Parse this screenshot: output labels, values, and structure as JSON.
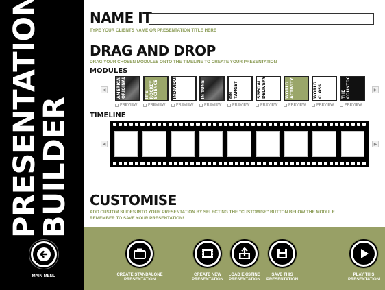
{
  "sidebar": {
    "title_lines": [
      "PRESENTATION",
      "BUILDER"
    ],
    "main_menu_label": "MAIN MENU"
  },
  "name_it": {
    "heading": "NAME IT",
    "subtitle": "TYPE YOUR CLIENTS NAME OR PRESENTATION TITLE HERE",
    "input_value": ""
  },
  "drag_drop": {
    "heading": "DRAG AND DROP",
    "subtitle": "DRAG YOUR CHOSEN MODULES ONTO  THE TIMELINE TO CREATE YOUR PRESENTATION"
  },
  "modules": {
    "label": "MODULES",
    "prev_arrow": "◀",
    "next_arrow": "▶",
    "items": [
      {
        "lines": [
          "AMERICAN",
          "ORIGINAL"
        ],
        "style": "photo",
        "text_color": "light",
        "preview": "PREVIEW"
      },
      {
        "lines": [
          "IT'S",
          "ROCKET",
          "SCIENCE"
        ],
        "style": "green",
        "text_color": "light",
        "preview": "PREVIEW"
      },
      {
        "lines": [
          "INDIVIDUALS"
        ],
        "style": "white",
        "text_color": "dark",
        "preview": "PREVIEW"
      },
      {
        "lines": [
          "IN TUNE"
        ],
        "style": "photo",
        "text_color": "light",
        "preview": "PREVIEW"
      },
      {
        "lines": [
          "ON",
          "TARGET"
        ],
        "style": "white",
        "text_color": "dark",
        "preview": "PREVIEW"
      },
      {
        "lines": [
          "SPECIAL",
          "DELIVERY"
        ],
        "style": "white",
        "text_color": "dark",
        "preview": "PREVIEW"
      },
      {
        "lines": [
          "WORLD",
          "ACTIVITY"
        ],
        "style": "green",
        "text_color": "light",
        "preview": "PREVIEW"
      },
      {
        "lines": [
          "WORLD",
          "CLASS"
        ],
        "style": "white",
        "text_color": "dark",
        "preview": "PREVIEW"
      },
      {
        "lines": [
          "THE",
          "COUNTDOWN"
        ],
        "style": "black",
        "text_color": "light",
        "preview": "PREVIEW"
      }
    ]
  },
  "timeline": {
    "label": "TIMELINE",
    "prev_arrow": "◀",
    "next_arrow": "▶",
    "slot_count": 9
  },
  "customise": {
    "heading": "CUSTOMISE",
    "subtitle_line1": "ADD CUSTOM SLIDES INTO YOUR PRESENTATION BY SELECTING THE \"CUSTOMISE\" BUTTON BELOW THE MODULE",
    "subtitle_line2": "REMEMBER TO SAVE YOUR PRESENTATION!"
  },
  "actions": [
    {
      "id": "create-standalone",
      "icon": "briefcase-icon",
      "label": "CREATE STANDALONE PRESENTATION"
    },
    {
      "id": "create-new",
      "icon": "film-icon",
      "label": "CREATE NEW PRESENTATION"
    },
    {
      "id": "load-existing",
      "icon": "upload-icon",
      "label": "LOAD EXISTING PRESENTATION"
    },
    {
      "id": "save",
      "icon": "save-icon",
      "label": "SAVE THIS PRESENTATION"
    },
    {
      "id": "play",
      "icon": "play-icon",
      "label": "PLAY THIS PRESENTATION"
    }
  ],
  "colors": {
    "accent_green": "#98a066",
    "subtitle_green": "#8a9b55",
    "sidebar": "#000000"
  }
}
